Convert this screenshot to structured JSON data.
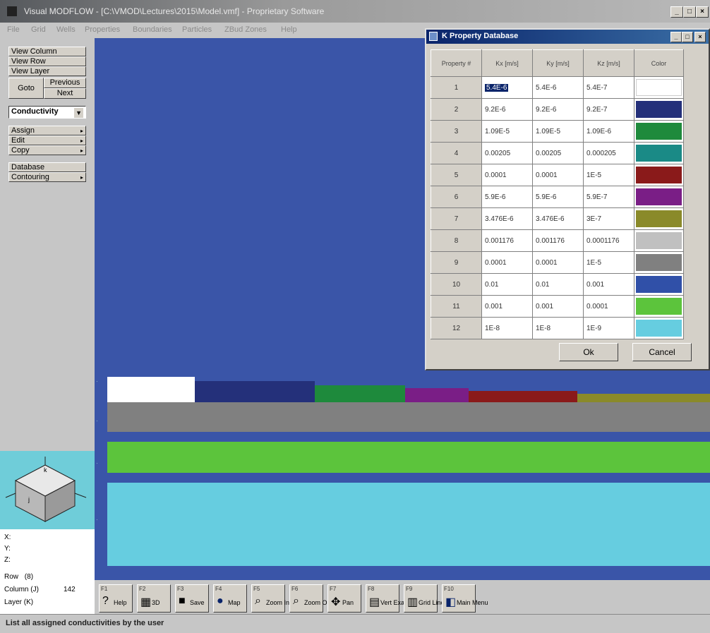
{
  "window": {
    "title": "Visual MODFLOW - [C:\\VMOD\\Lectures\\2015\\Model.vmf] - Proprietary Software"
  },
  "menu": [
    "File",
    "Grid",
    "Wells",
    "Properties",
    "Boundaries",
    "Particles",
    "ZBud Zones",
    "Help"
  ],
  "left_panel": {
    "view_column": "View Column",
    "view_row": "View Row",
    "view_layer": "View Layer",
    "goto": "Goto",
    "previous": "Previous",
    "next": "Next",
    "property_select": "Conductivity",
    "assign": "Assign",
    "edit": "Edit",
    "copy": "Copy",
    "database": "Database",
    "contouring": "Contouring"
  },
  "cube_labels": {
    "top": "k",
    "side": "j"
  },
  "info": {
    "x": "X:",
    "y": "Y:",
    "z": "Z:",
    "row_label": "Row",
    "row_value": "(8)",
    "column_label": "Column (J)",
    "column_value": "142",
    "layer_label": "Layer (K)"
  },
  "toolbar": [
    {
      "key": "F1",
      "label": "Help",
      "icon": "?"
    },
    {
      "key": "F2",
      "label": "3D",
      "icon": "▦"
    },
    {
      "key": "F3",
      "label": "Save",
      "icon": "■"
    },
    {
      "key": "F4",
      "label": "Map",
      "icon": "●"
    },
    {
      "key": "F5",
      "label": "Zoom In",
      "icon": "⌕"
    },
    {
      "key": "F6",
      "label": "Zoom Out",
      "icon": "⌕"
    },
    {
      "key": "F7",
      "label": "Pan",
      "icon": "✥"
    },
    {
      "key": "F8",
      "label": "Vert Exag",
      "icon": "▤"
    },
    {
      "key": "F9",
      "label": "Grid Lines",
      "icon": "▥"
    },
    {
      "key": "F10",
      "label": "Main Menu",
      "icon": "◧"
    }
  ],
  "status": "List all assigned conductivities by the user",
  "dialog": {
    "title": "K Property Database",
    "headers": [
      "Property #",
      "Kx [m/s]",
      "Ky [m/s]",
      "Kz [m/s]",
      "Color"
    ],
    "rows": [
      {
        "id": "1",
        "kx": "5.4E-6",
        "ky": "5.4E-6",
        "kz": "5.4E-7",
        "color": "#ffffff"
      },
      {
        "id": "2",
        "kx": "9.2E-6",
        "ky": "9.2E-6",
        "kz": "9.2E-7",
        "color": "#24307a"
      },
      {
        "id": "3",
        "kx": "1.09E-5",
        "ky": "1.09E-5",
        "kz": "1.09E-6",
        "color": "#1e8a3c"
      },
      {
        "id": "4",
        "kx": "0.00205",
        "ky": "0.00205",
        "kz": "0.000205",
        "color": "#1a8a86"
      },
      {
        "id": "5",
        "kx": "0.0001",
        "ky": "0.0001",
        "kz": "1E-5",
        "color": "#8a1a1a"
      },
      {
        "id": "6",
        "kx": "5.9E-6",
        "ky": "5.9E-6",
        "kz": "5.9E-7",
        "color": "#7a1e86"
      },
      {
        "id": "7",
        "kx": "3.476E-6",
        "ky": "3.476E-6",
        "kz": "3E-7",
        "color": "#8a8a2a"
      },
      {
        "id": "8",
        "kx": "0.001176",
        "ky": "0.001176",
        "kz": "0.0001176",
        "color": "#c0c0c0"
      },
      {
        "id": "9",
        "kx": "0.0001",
        "ky": "0.0001",
        "kz": "1E-5",
        "color": "#808080"
      },
      {
        "id": "10",
        "kx": "0.01",
        "ky": "0.01",
        "kz": "0.001",
        "color": "#3050a8"
      },
      {
        "id": "11",
        "kx": "0.001",
        "ky": "0.001",
        "kz": "0.0001",
        "color": "#5cc43c"
      },
      {
        "id": "12",
        "kx": "1E-8",
        "ky": "1E-8",
        "kz": "1E-9",
        "color": "#66cde0"
      }
    ],
    "ok": "Ok",
    "cancel": "Cancel"
  },
  "xsection_colors": {
    "background": "#3a55a8",
    "layer_top": [
      "#ffffff",
      "#24307a",
      "#1e8a3c",
      "#7a1e86",
      "#8a1a1a",
      "#8a8a2a"
    ],
    "layer2": "#808080",
    "layer3": "#5cc43c",
    "layer4": "#66cde0"
  }
}
